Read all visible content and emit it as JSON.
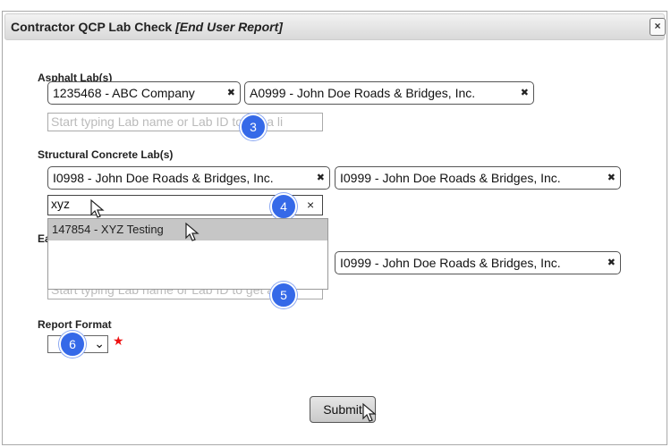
{
  "dialog": {
    "title": "Contractor QCP Lab Check",
    "title_suffix": "[End User Report]",
    "close_label": "×"
  },
  "asphalt": {
    "label": "Asphalt Lab(s)",
    "tags": [
      "1235468 - ABC Company",
      "A0999 - John Doe Roads & Bridges, Inc."
    ],
    "placeholder": "Start typing Lab name or Lab ID to get a li"
  },
  "structural": {
    "label": "Structural Concrete Lab(s)",
    "tags": [
      "I0998 - John Doe Roads & Bridges, Inc.",
      "I0999 - John Doe Roads & Bridges, Inc."
    ],
    "input_value": "xyz",
    "clear_label": "×",
    "dropdown_option": "147854 - XYZ Testing"
  },
  "earthwork": {
    "label": "Ea",
    "tags": [
      "I0999 - John Doe Roads & Bridges, Inc."
    ],
    "placeholder": "Start typing Lab name or Lab ID to get a li"
  },
  "report_format": {
    "label": "Report Format",
    "required_mark": "★"
  },
  "submit_label": "Submit",
  "badges": [
    "3",
    "4",
    "5",
    "6"
  ],
  "tag_remove": "✖",
  "colors": {
    "badge": "#3569e8",
    "required": "#e11111",
    "highlight": "#c6c6c6"
  }
}
